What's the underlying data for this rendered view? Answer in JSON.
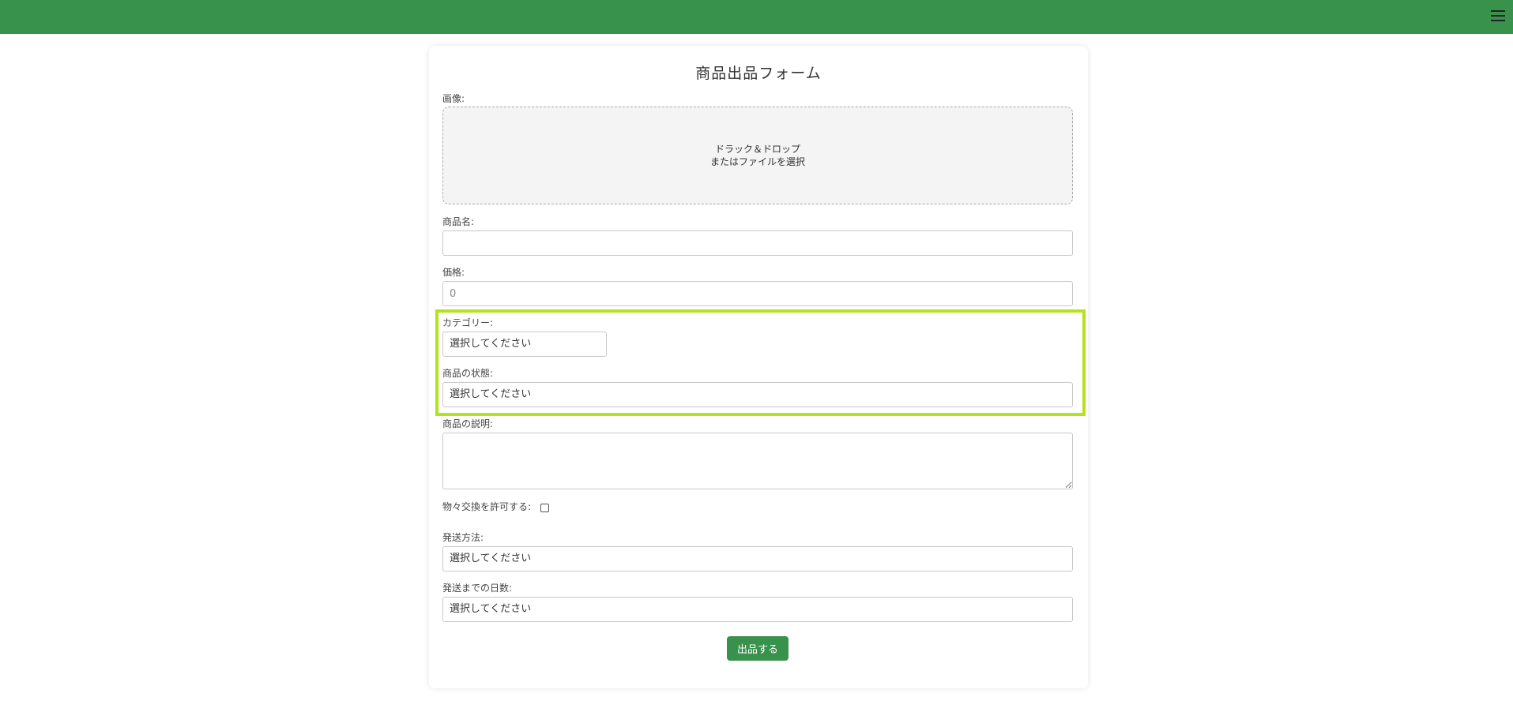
{
  "header": {
    "menu_icon": "hamburger-menu-icon",
    "bar_color": "#38924b"
  },
  "form": {
    "title": "商品出品フォーム",
    "image_label": "画像:",
    "dropzone_line1": "ドラック＆ドロップ",
    "dropzone_line2": "またはファイルを選択",
    "name_label": "商品名:",
    "name_value": "",
    "price_label": "価格:",
    "price_placeholder": "0",
    "category_label": "カテゴリー:",
    "category_value": "選択してください",
    "condition_label": "商品の状態:",
    "condition_value": "選択してください",
    "description_label": "商品の説明:",
    "description_value": "",
    "barter_label": "物々交換を許可する:",
    "barter_checked": false,
    "shipping_method_label": "発送方法:",
    "shipping_method_value": "選択してください",
    "shipping_days_label": "発送までの日数:",
    "shipping_days_value": "選択してください",
    "submit_label": "出品する",
    "accent_color": "#38924b",
    "highlight_color": "#b4e21c"
  }
}
